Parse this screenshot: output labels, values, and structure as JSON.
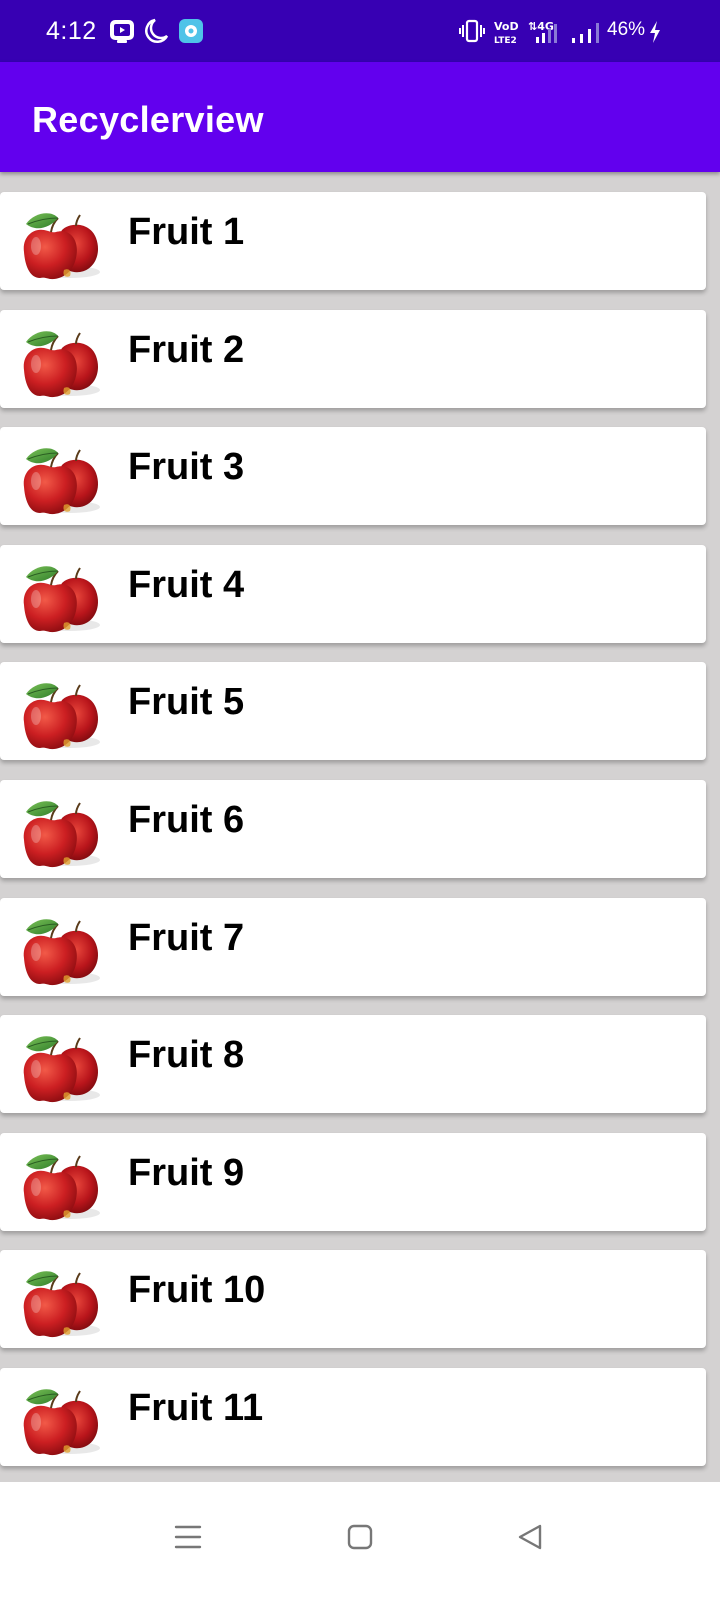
{
  "status_bar": {
    "time": "4:12",
    "battery": "46%",
    "icons": [
      "tv-app-icon",
      "moon-icon",
      "assistant-app-icon",
      "vibrate-icon",
      "volte-icon",
      "4g-icon",
      "signal-icon",
      "signal-2-icon",
      "charging-icon"
    ]
  },
  "app_bar": {
    "title": "Recyclerview",
    "color": "#6200ee",
    "status_color": "#3700b3"
  },
  "list": {
    "items": [
      {
        "label": "Fruit 1",
        "icon": "apple-icon"
      },
      {
        "label": "Fruit 2",
        "icon": "apple-icon"
      },
      {
        "label": "Fruit 3",
        "icon": "apple-icon"
      },
      {
        "label": "Fruit 4",
        "icon": "apple-icon"
      },
      {
        "label": "Fruit 5",
        "icon": "apple-icon"
      },
      {
        "label": "Fruit 6",
        "icon": "apple-icon"
      },
      {
        "label": "Fruit 7",
        "icon": "apple-icon"
      },
      {
        "label": "Fruit 8",
        "icon": "apple-icon"
      },
      {
        "label": "Fruit 9",
        "icon": "apple-icon"
      },
      {
        "label": "Fruit 10",
        "icon": "apple-icon"
      },
      {
        "label": "Fruit 11",
        "icon": "apple-icon"
      }
    ]
  },
  "nav_bar": {
    "buttons": [
      "menu-icon",
      "home-icon",
      "back-icon"
    ]
  }
}
